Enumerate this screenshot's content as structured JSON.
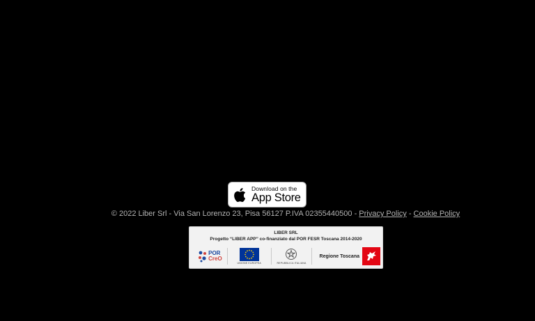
{
  "appstore": {
    "small_text": "Download on the",
    "large_text": "App Store",
    "icon": "apple-icon"
  },
  "footer": {
    "legal_text": "© 2022 Liber Srl - Via San Lorenzo 23, Pisa 56127 P.IVA 02355440500 - ",
    "privacy_link": "Privacy Policy",
    "separator": " - ",
    "cookie_link": "Cookie Policy"
  },
  "funding": {
    "title": "LIBER SRL",
    "subtitle": "Progetto “LIBER APP” co-finanziato dal POR FESR Toscana 2014-2020",
    "logos": {
      "porcreo_line1": "POR",
      "porcreo_line2": "CreO",
      "eu_caption": "UNIONE EUROPEA",
      "repubblica_caption": "REPUBBLICA ITALIANA",
      "regione_label": "Regione Toscana"
    }
  },
  "colors": {
    "background": "#000000",
    "footer_text": "#b3b3b3",
    "eu_blue": "#003399",
    "eu_star": "#ffcc00",
    "toscana_red": "#e30613"
  }
}
